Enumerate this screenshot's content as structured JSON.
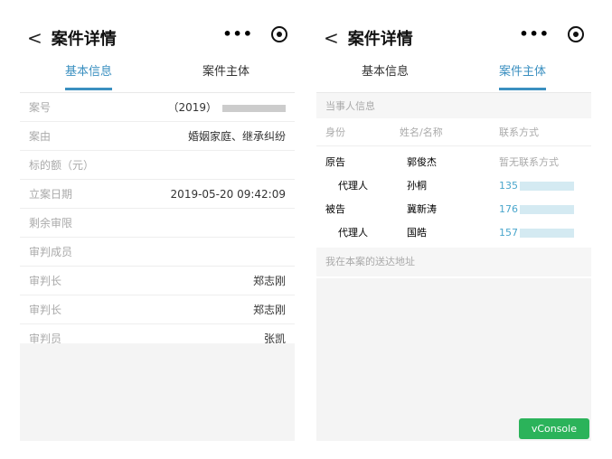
{
  "nav": {
    "title": "案件详情",
    "more": "•••"
  },
  "tabs": [
    "基本信息",
    "案件主体"
  ],
  "basic": {
    "rows": [
      {
        "label": "案号",
        "value": "（2019）"
      },
      {
        "label": "案由",
        "value": "婚姻家庭、继承纠纷"
      },
      {
        "label": "标的额（元）",
        "value": ""
      },
      {
        "label": "立案日期",
        "value": "2019-05-20 09:42:09"
      },
      {
        "label": "剩余审限",
        "value": ""
      },
      {
        "label": "审判成员",
        "value": ""
      },
      {
        "label": "审判长",
        "value": "郑志刚"
      },
      {
        "label": "审判长",
        "value": "郑志刚"
      },
      {
        "label": "审判员",
        "value": "张凯"
      }
    ]
  },
  "parties": {
    "section": "当事人信息",
    "headers": [
      "身份",
      "姓名/名称",
      "联系方式"
    ],
    "rows": [
      {
        "role": "原告",
        "name": "郭俊杰",
        "contact": "暂无联系方式"
      },
      {
        "role": "代理人",
        "name": "孙桐",
        "contact": "135"
      },
      {
        "role": "被告",
        "name": "冀新涛",
        "contact": "176"
      },
      {
        "role": "代理人",
        "name": "国皓",
        "contact": "157"
      }
    ],
    "address_section": "我在本案的送达地址"
  },
  "vconsole": "vConsole"
}
